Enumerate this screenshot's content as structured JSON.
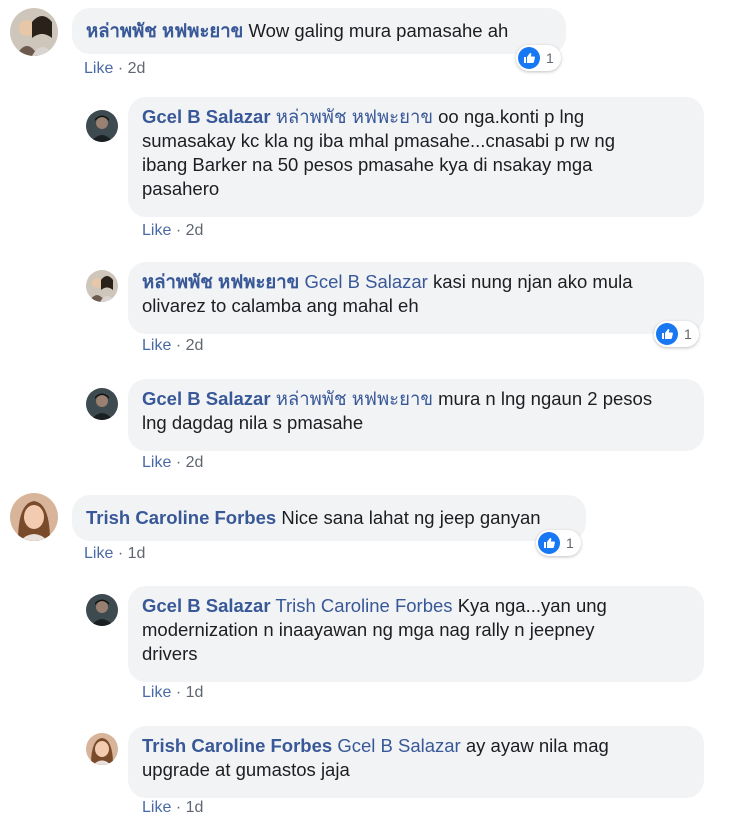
{
  "colors": {
    "link": "#385898",
    "bubble": "#f2f3f5",
    "like_blue": "#1877f2"
  },
  "comments": [
    {
      "author": "หล่าพพัช หฟพะยาข",
      "tag": "",
      "text": "Wow galing mura pamasahe ah",
      "like": "Like",
      "dot": "·",
      "time": "2d",
      "reactions": "1",
      "reaction_icon": "like-thumb-icon"
    },
    {
      "author": "Gcel B Salazar",
      "tag": "หล่าพพัช หฟพะยาข",
      "line1": "oo nga.konti p lng",
      "line2": "sumasakay kc kla ng iba mhal pmasahe...cnasabi p rw ng",
      "line3": "ibang Barker na 50 pesos pmasahe kya di nsakay mga",
      "line4": "pasahero",
      "like": "Like",
      "dot": "·",
      "time": "2d"
    },
    {
      "author": "หล่าพพัช หฟพะยาข",
      "tag": "Gcel B Salazar",
      "line1": "kasi nung njan ako mula",
      "line2": "olivarez to calamba ang mahal eh",
      "like": "Like",
      "dot": "·",
      "time": "2d",
      "reactions": "1"
    },
    {
      "author": "Gcel B Salazar",
      "tag": "หล่าพพัช หฟพะยาข",
      "line1": "mura n lng ngaun 2 pesos",
      "line2": "lng dagdag nila s pmasahe",
      "like": "Like",
      "dot": "·",
      "time": "2d"
    },
    {
      "author": "Trish Caroline Forbes",
      "tag": "",
      "text": "Nice sana lahat ng jeep ganyan",
      "like": "Like",
      "dot": "·",
      "time": "1d",
      "reactions": "1"
    },
    {
      "author": "Gcel B Salazar",
      "tag": "Trish Caroline Forbes",
      "line1": "Kya nga...yan ung",
      "line2": "modernization n inaayawan ng mga nag rally n jeepney",
      "line3": "drivers",
      "like": "Like",
      "dot": "·",
      "time": "1d"
    },
    {
      "author": "Trish Caroline Forbes",
      "tag": "Gcel B Salazar",
      "line1": "ay ayaw nila mag",
      "line2": "upgrade at gumastos jaja",
      "like": "Like",
      "dot": "·",
      "time": "1d"
    }
  ]
}
